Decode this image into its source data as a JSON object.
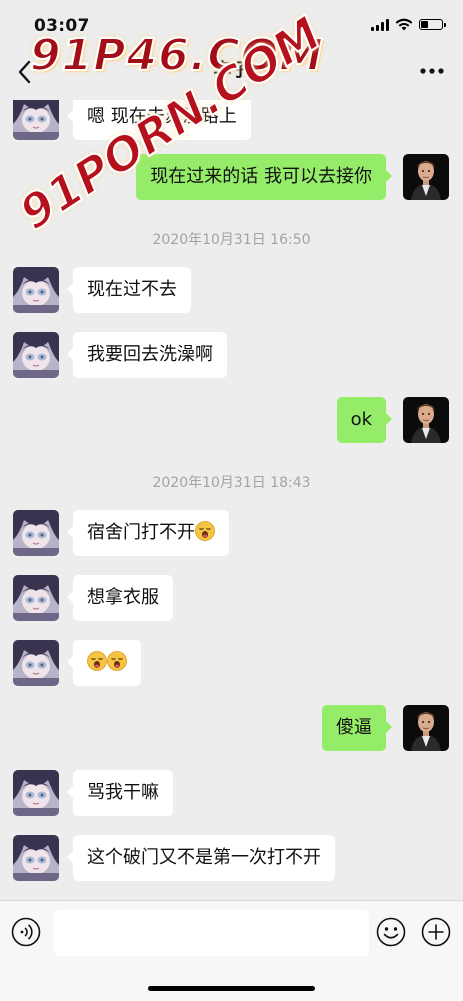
{
  "status_bar": {
    "time": "03:07",
    "battery_level": 0.35,
    "signal_bars": 4
  },
  "nav": {
    "title": "李子"
  },
  "watermark": {
    "title": "91P46.COM",
    "diagonal": "91PORN.COM"
  },
  "colors": {
    "bubble_self": "#95ec69",
    "bubble_other": "#ffffff",
    "background": "#ededed",
    "timestamp": "#a3a3a3"
  },
  "messages": [
    {
      "sender": "other",
      "text": "嗯 现在去苏溪路上"
    },
    {
      "sender": "self",
      "text": "现在过来的话 我可以去接你"
    },
    {
      "type": "timestamp",
      "text": "2020年10月31日 16:50"
    },
    {
      "sender": "other",
      "text": "现在过不去"
    },
    {
      "sender": "other",
      "text": "我要回去洗澡啊"
    },
    {
      "sender": "self",
      "text": "ok"
    },
    {
      "type": "timestamp",
      "text": "2020年10月31日 18:43"
    },
    {
      "sender": "other",
      "text": "宿舍门打不开",
      "emoji": [
        "yawning-face-emoji"
      ]
    },
    {
      "sender": "other",
      "text": "想拿衣服"
    },
    {
      "sender": "other",
      "text": "",
      "emoji": [
        "yawning-face-emoji",
        "yawning-face-emoji"
      ]
    },
    {
      "sender": "self",
      "text": "傻逼"
    },
    {
      "sender": "other",
      "text": "骂我干嘛"
    },
    {
      "sender": "other",
      "text": "这个破门又不是第一次打不开"
    }
  ],
  "input_bar": {
    "placeholder": "",
    "icons": [
      "voice-icon",
      "emoji-icon",
      "plus-icon"
    ]
  }
}
